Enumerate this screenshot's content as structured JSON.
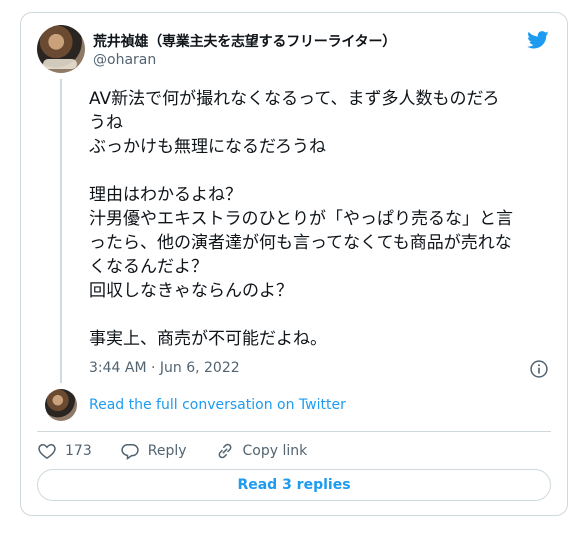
{
  "tweet": {
    "author_name": "荒井禎雄（専業主夫を志望するフリーライター）",
    "handle": "@oharan",
    "text_lines": [
      "AV新法で何が撮れなくなるって、まず多人数ものだろ",
      "うね",
      "ぶっかけも無理になるだろうね",
      "",
      "理由はわかるよね？",
      "汁男優やエキストラのひとりが「やっぱり売るな」と言",
      "ったら、他の演者達が何も言ってなくても商品が売れな",
      "くなるんだよ？",
      "回収しなきゃならんのよ？",
      "",
      "事実上、商売が不可能だよね。"
    ],
    "timestamp": "3:44 AM · Jun 6, 2022",
    "read_full_label": "Read the full conversation on Twitter",
    "like_count": "173",
    "reply_label": "Reply",
    "copy_link_label": "Copy link",
    "read_replies_label": "Read 3 replies"
  },
  "colors": {
    "accent": "#1d9bf0",
    "muted": "#536471",
    "border": "#cfd9de"
  },
  "icons": [
    "twitter-bird-icon",
    "info-icon",
    "heart-icon",
    "reply-icon",
    "link-icon"
  ]
}
